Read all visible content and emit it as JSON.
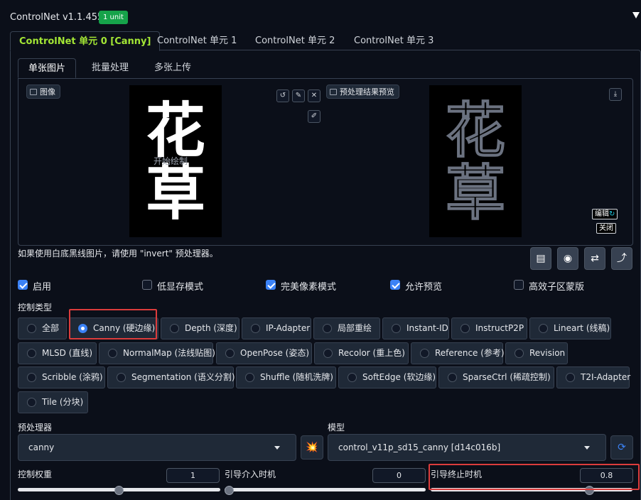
{
  "header": {
    "title": "ControlNet v1.1.455",
    "badge": "1 unit"
  },
  "tabs": [
    "ControlNet 单元 0 [Canny]",
    "ControlNet 单元 1",
    "ControlNet 单元 2",
    "ControlNet 单元 3"
  ],
  "subtabs": [
    "单张图片",
    "批量处理",
    "多张上传"
  ],
  "image_panel": {
    "image_label": "图像",
    "preview_label": "预处理结果预览",
    "canvas_text": "开始绘制",
    "chars": [
      "花",
      "草"
    ],
    "edit_label": "编辑",
    "close_label": "关闭"
  },
  "hint": "如果使用白底黑线图片，请使用 \"invert\" 预处理器。",
  "checkboxes": [
    {
      "label": "启用",
      "checked": true
    },
    {
      "label": "低显存模式",
      "checked": false
    },
    {
      "label": "完美像素模式",
      "checked": true
    },
    {
      "label": "允许预览",
      "checked": true
    },
    {
      "label": "高效子区蒙版",
      "checked": false
    }
  ],
  "control_type_label": "控制类型",
  "control_types": [
    "全部",
    "Canny (硬边缘)",
    "Depth (深度)",
    "IP-Adapter",
    "局部重绘",
    "Instant-ID",
    "InstructP2P",
    "Lineart (线稿)",
    "MLSD (直线)",
    "NormalMap (法线贴图)",
    "OpenPose (姿态)",
    "Recolor (重上色)",
    "Reference (参考)",
    "Revision",
    "Scribble (涂鸦)",
    "Segmentation (语义分割)",
    "Shuffle (随机洗牌)",
    "SoftEdge (软边缘)",
    "SparseCtrl (稀疏控制)",
    "T2I-Adapter",
    "Tile (分块)"
  ],
  "selected_control_type": "Canny (硬边缘)",
  "preprocessor": {
    "label": "预处理器",
    "value": "canny"
  },
  "model": {
    "label": "模型",
    "value": "control_v11p_sd15_canny [d14c016b]"
  },
  "sliders": [
    {
      "label": "控制权重",
      "value": "1",
      "fraction": 0.5
    },
    {
      "label": "引导介入时机",
      "value": "0",
      "fraction": 0.0
    },
    {
      "label": "引导终止时机",
      "value": "0.8",
      "fraction": 0.8
    }
  ],
  "colors": {
    "accent": "#a3e635",
    "badge": "#16a34a",
    "checked": "#3b82f6",
    "highlight": "#dc3c3c"
  }
}
